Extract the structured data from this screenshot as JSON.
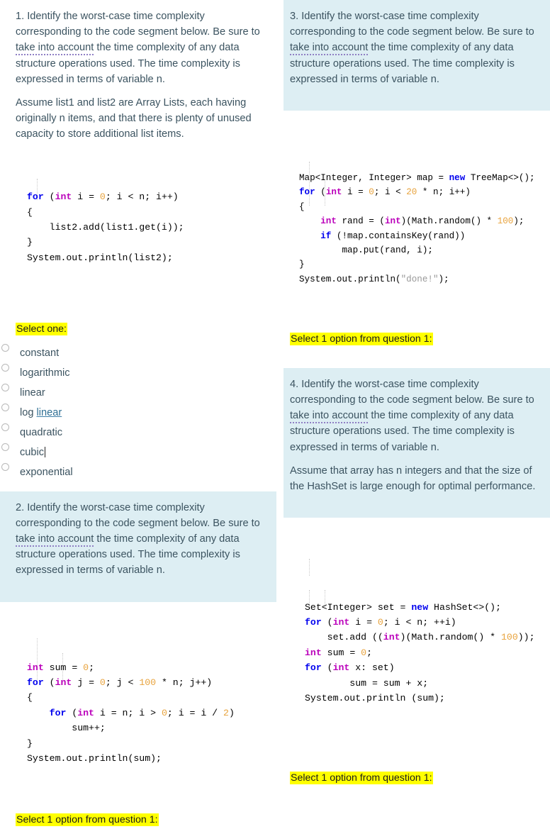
{
  "grammar_phrase": "take into account",
  "shared_prompt": {
    "lead_1": "Identify the worst-case time complexity",
    "lead_2": "corresponding to the code segment below.  Be",
    "lead_3a": "sure to ",
    "lead_3b": " the time complexity of",
    "lead_4": "any data structure operations used.  The time",
    "lead_5": "complexity is expressed in terms of variable n."
  },
  "questions": [
    {
      "number": "1.",
      "shaded": false,
      "extra_paragraph": "Assume list1 and list2 are Array Lists, each having originally n items, and that there is plenty of unused capacity to store additional list items.",
      "code_lines": [
        "for (int i = 0; i < n; i++)",
        "{",
        "    list2.add(list1.get(i));",
        "}",
        "System.out.println(list2);"
      ],
      "instruction": "Select one:"
    },
    {
      "number": "2.",
      "shaded": true,
      "extra_paragraph": "",
      "code_lines": [
        "int sum = 0;",
        "for (int j = 0; j < 100 * n; j++)",
        "{",
        "    for (int i = n; i > 0; i = i / 2)",
        "        sum++;",
        "}",
        "System.out.println(sum);"
      ],
      "instruction": "Select 1 option from question 1:"
    },
    {
      "number": "3.",
      "shaded": true,
      "extra_paragraph": "",
      "code_lines": [
        "Map<Integer, Integer> map = new TreeMap<>();",
        "for (int i = 0; i < 20 * n; i++)",
        "{",
        "    int rand = (int)(Math.random() * 100);",
        "    if (!map.containsKey(rand))",
        "        map.put(rand, i);",
        "}",
        "System.out.println(\"done!\");"
      ],
      "instruction": "Select 1 option from question 1:"
    },
    {
      "number": "4.",
      "shaded": true,
      "extra_paragraph": "Assume that array has n integers and that the size of the HashSet is large enough for optimal performance.",
      "code_lines": [
        "Set<Integer> set = new HashSet<>();",
        "for (int i = 0; i < n; ++i)",
        "    set.add ((int)(Math.random() * 100));",
        "int sum = 0;",
        "for (int x: set)",
        "        sum = sum + x;",
        "System.out.println (sum);"
      ],
      "instruction": "Select 1 option from question 1:"
    }
  ],
  "answer_options": [
    {
      "label": "constant",
      "linked_word": ""
    },
    {
      "label": "logarithmic",
      "linked_word": ""
    },
    {
      "label": "linear",
      "linked_word": ""
    },
    {
      "label": "log linear",
      "linked_word": "linear"
    },
    {
      "label": "quadratic",
      "linked_word": ""
    },
    {
      "label": "cubic",
      "linked_word": "",
      "caret": true
    },
    {
      "label": "exponential",
      "linked_word": ""
    }
  ],
  "colors": {
    "prompt_text": "#3b5360",
    "shaded_background": "#ddeef3",
    "highlight": "#ffff00",
    "keyword": "#0000ee",
    "type": "#bb00bb",
    "number": "#e8a33d",
    "string": "#999999",
    "grammar_underline": "#8f7fc4",
    "link": "#2f6f93"
  }
}
